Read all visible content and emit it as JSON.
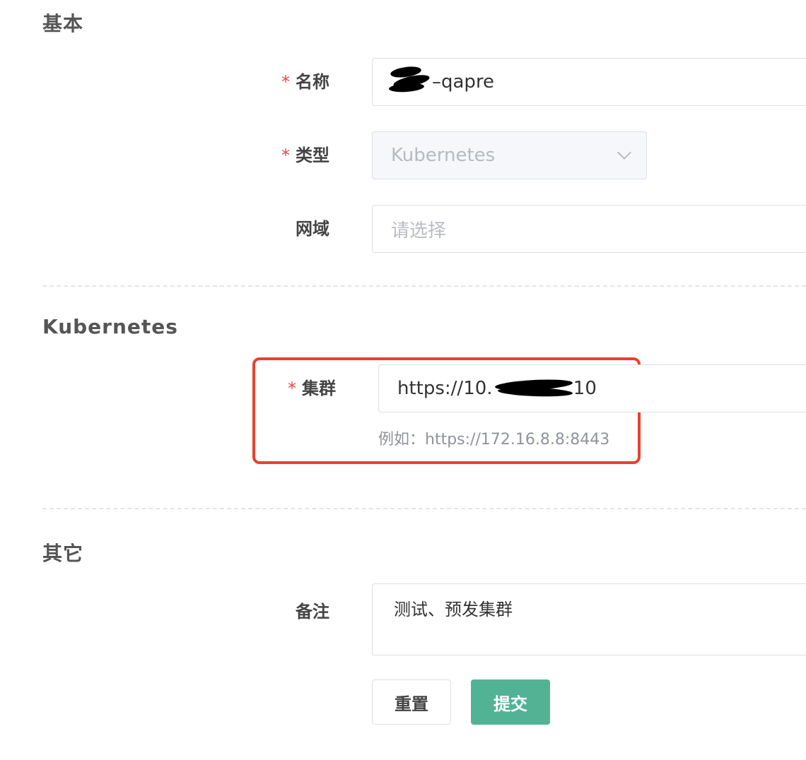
{
  "sections": {
    "basic": "基本",
    "kubernetes": "Kubernetes",
    "other": "其它"
  },
  "fields": {
    "name": {
      "label": "名称",
      "required": "*",
      "value": "–qapre"
    },
    "type": {
      "label": "类型",
      "required": "*",
      "value": "Kubernetes"
    },
    "domain": {
      "label": "网域",
      "placeholder": "请选择"
    },
    "cluster": {
      "label": "集群",
      "required": "*",
      "value_prefix": "https://10.",
      "value_suffix": ".10",
      "hint": "例如：https://172.16.8.8:8443"
    },
    "remark": {
      "label": "备注",
      "value": "测试、预发集群"
    }
  },
  "buttons": {
    "reset": "重置",
    "submit": "提交"
  },
  "colors": {
    "primary": "#52b394",
    "required": "#e5484d",
    "highlight": "#e8412f"
  },
  "icons": {
    "select_arrow": "chevron-down-icon"
  }
}
